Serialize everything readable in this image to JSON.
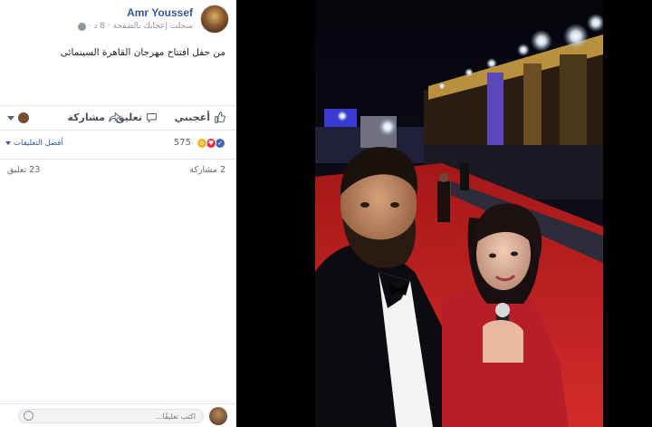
{
  "post": {
    "author": "Amr Youssef",
    "meta": "سجلت إعجابك بالصفحة · 8 د ·",
    "text": "من حفل افتتاح مهرجان القاهرة السينمائى"
  },
  "actions": {
    "like": "أعجبني",
    "comment": "تعليق",
    "share": "مشاركة"
  },
  "reactions": {
    "count": "575",
    "top_comments": "أفضل التعليقات"
  },
  "stats": {
    "shares": "2 مشاركة",
    "comments": "23 تعليق"
  },
  "comment_box": {
    "placeholder": "اكتب تعليقًا..."
  },
  "icons": [
    "globe-icon",
    "thumbs-up-icon",
    "comment-icon",
    "share-icon",
    "like-reaction-icon",
    "love-reaction-icon",
    "wow-reaction-icon",
    "emoji-icon"
  ],
  "colors": {
    "link": "#365899",
    "like": "#4267b2",
    "love": "#f0284a",
    "wow": "#f7b125",
    "carpet": "#c41f1f"
  }
}
